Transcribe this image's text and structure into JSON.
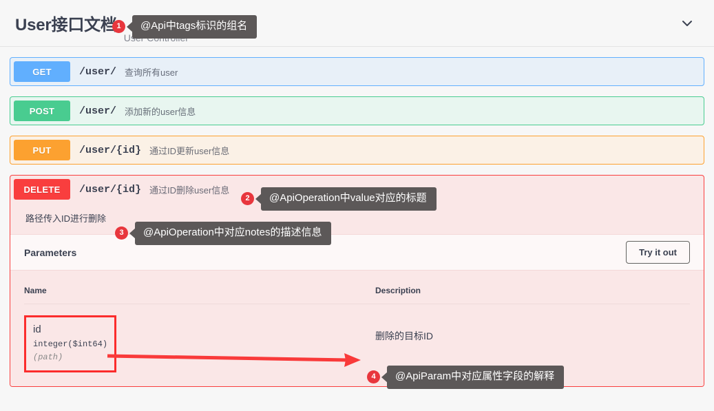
{
  "header": {
    "title": "User接口文档",
    "subtitle": "User Controller",
    "chevron_icon": "chevron-down-icon"
  },
  "operations": [
    {
      "method": "GET",
      "path": "/user/",
      "summary": "查询所有user",
      "color": "#61affe",
      "bg": "#e8f0f8"
    },
    {
      "method": "POST",
      "path": "/user/",
      "summary": "添加新的user信息",
      "color": "#49cc90",
      "bg": "#e8f6f0"
    },
    {
      "method": "PUT",
      "path": "/user/{id}",
      "summary": "通过ID更新user信息",
      "color": "#fca130",
      "bg": "#fbf1e6"
    }
  ],
  "delete_operation": {
    "method": "DELETE",
    "path": "/user/{id}",
    "summary": "通过ID删除user信息",
    "notes": "路径传入ID进行删除",
    "color": "#f93e3e",
    "bg": "#fae7e7",
    "parameters_title": "Parameters",
    "try_it_out_label": "Try it out",
    "table": {
      "columns": [
        "Name",
        "Description"
      ],
      "rows": [
        {
          "name": "id",
          "type": "integer($int64)",
          "in": "(path)",
          "description": "删除的目标ID"
        }
      ]
    }
  },
  "annotations": [
    {
      "number": "1",
      "text": "@Api中tags标识的组名"
    },
    {
      "number": "2",
      "text": "@ApiOperation中value对应的标题"
    },
    {
      "number": "3",
      "text": "@ApiOperation中对应notes的描述信息"
    },
    {
      "number": "4",
      "text": "@ApiParam中对应属性字段的解释"
    }
  ],
  "colors": {
    "badge_red": "#e8363d",
    "callout_gray": "#5c5858",
    "highlight_red": "#fb2c2c",
    "arrow_red": "#f93a3a"
  }
}
